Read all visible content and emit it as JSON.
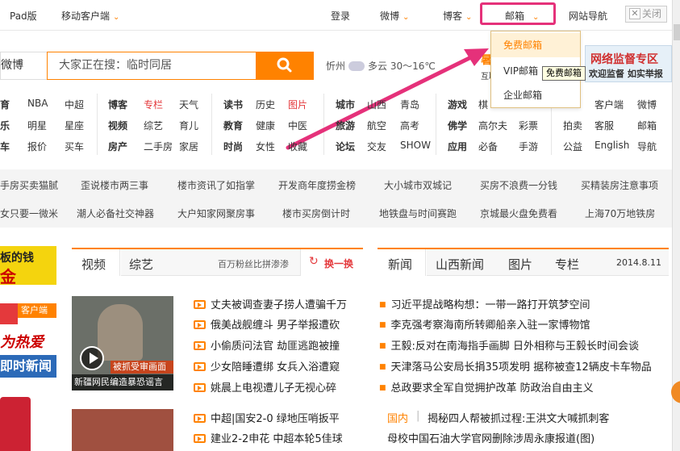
{
  "topbar": {
    "pad": "Pad版",
    "mobile": "移动客户端",
    "login": "登录",
    "weibo": "微博",
    "blog": "博客",
    "mail": "邮箱",
    "nav": "网站导航",
    "close": "关闭"
  },
  "mail_dropdown": {
    "items": [
      "免费邮箱",
      "VIP邮箱",
      "企业邮箱"
    ],
    "tooltip": "免费邮箱"
  },
  "search": {
    "tab": "微博",
    "placeholder": "大家正在搜：临时同居",
    "weather": "忻州",
    "weather_desc": "多云  30～16℃"
  },
  "ad_right": {
    "line1": "网络监督专区",
    "line2": "欢迎监督 如实举报"
  },
  "ad_partial": {
    "l1": "暑",
    "l2": "互联"
  },
  "links": {
    "col1": [
      "育",
      "乐",
      "车"
    ],
    "col2": [
      "NBA",
      "明星",
      "报价"
    ],
    "col3": [
      "中超",
      "星座",
      "买车"
    ],
    "col4": [
      "博客",
      "视频",
      "房产"
    ],
    "col5": [
      "专栏",
      "综艺",
      "二手房"
    ],
    "col6": [
      "天气",
      "育儿",
      "家居"
    ],
    "col7": [
      "读书",
      "教育",
      "时尚"
    ],
    "col8": [
      "历史",
      "健康",
      "女性"
    ],
    "col9": [
      "图片",
      "中医",
      "收藏"
    ],
    "col10": [
      "城市",
      "旅游",
      "论坛"
    ],
    "col11": [
      "山西",
      "航空",
      "交友"
    ],
    "col12": [
      "青岛",
      "高考",
      "SHOW"
    ],
    "col13": [
      "游戏",
      "佛学",
      "应用"
    ],
    "col14": [
      "棋",
      "高尔夫",
      "必备"
    ],
    "col15": [
      "",
      "彩票",
      "手游"
    ],
    "col16": [
      "",
      "拍卖",
      "公益"
    ],
    "col17": [
      "客户端",
      "客服",
      "English"
    ],
    "col18": [
      "微博",
      "邮箱",
      "导航"
    ]
  },
  "hot": {
    "row1": [
      "手房买卖猫腻",
      "歪说楼市两三事",
      "楼市资讯了如指掌",
      "开发商年度捞金榜",
      "大小城市双城记",
      "买房不浪费一分钱",
      "买精装房注意事项"
    ],
    "row2": [
      "女只要一微米",
      "潮人必备社交神器",
      "大户知家网聚房事",
      "楼市买房倒计时",
      "地铁盘与时间赛跑",
      "京城最火盘免费看",
      "上海70万地铁房"
    ]
  },
  "left_ad": {
    "a1": "板的钱",
    "a2": "金",
    "a3": "客户端",
    "a4": "为热爱",
    "a5": "即时新闻"
  },
  "video": {
    "tab1": "视频",
    "tab2": "综艺",
    "promo": "百万粉丝比拼渗渗",
    "refresh": "换一换",
    "thumb_badge": "被抓受审画面",
    "thumb_caption": "新疆网民编造暴恐谣言",
    "items": [
      "丈夫被调查妻子捞人遭骗千万",
      "俄美战舰缠斗 男子举报遭砍",
      "小偷质问法官 劫匪逃跑被撞",
      "少女陪睡遭绑 女兵入浴遭窥",
      "姚晨上电视遭儿子无视心碎"
    ],
    "items2": [
      "中超|国安2-0 绿地压哨扳平",
      "建业2-2申花 中超本轮5佳球"
    ]
  },
  "news": {
    "tab1": "新闻",
    "tab2": "山西新闻",
    "tab3": "图片",
    "tab4": "专栏",
    "date": "2014.8.11",
    "items": [
      "习近平提战略构想：一带一路打开筑梦空间",
      "李克强考察海南所转卿船亲入驻一家博物馆",
      "王毅:反对在南海指手画脚 日外相称与王毅长时间会谈",
      "天津落马公安局长捐35项发明 据称被查12辆皮卡车物品",
      "总政要求全军自觉拥护改革 防政治自由主义"
    ],
    "tag": "国内",
    "item6": "揭秘四人帮被抓过程:王洪文大喊抓刺客",
    "item7": "母校中国石油大学官网删除涉周永康报道(图)"
  },
  "colors": {
    "accent": "#ff8200",
    "highlight": "#e5317a"
  },
  "icons": [
    "chevron-down-icon",
    "close-icon",
    "search-icon",
    "cloud-icon",
    "video-icon",
    "refresh-icon",
    "play-icon"
  ]
}
